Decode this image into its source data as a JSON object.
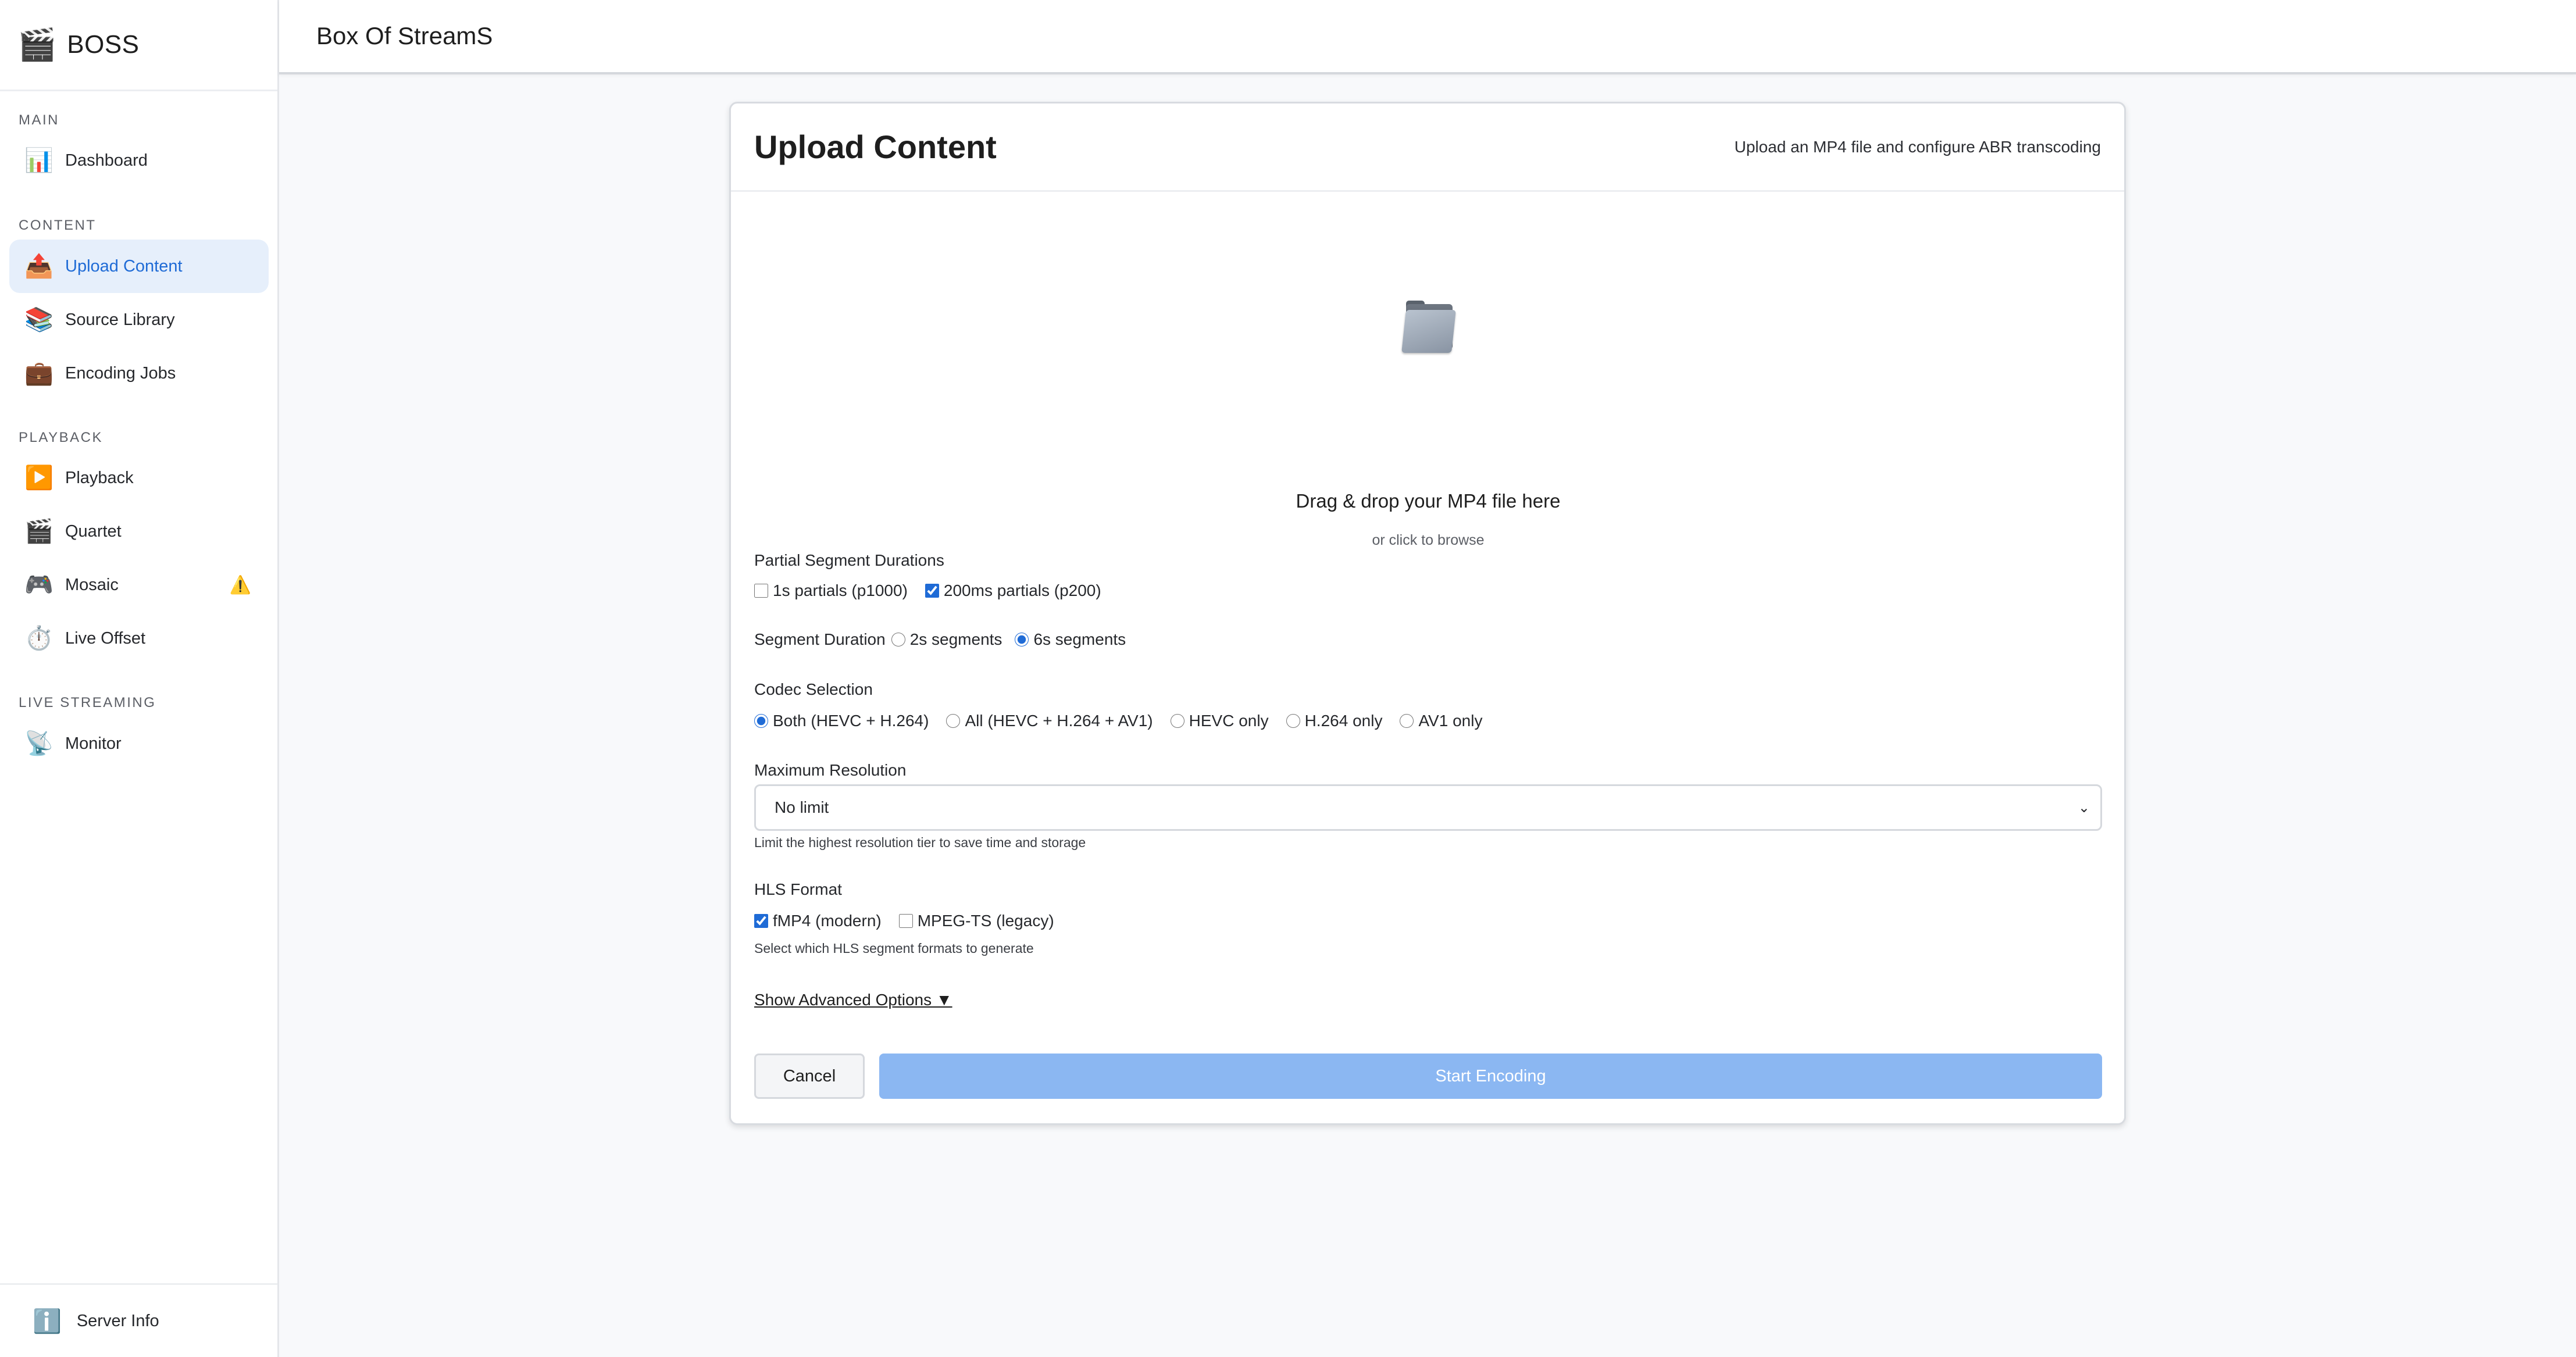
{
  "brand": {
    "icon": "clapper-icon",
    "name": "BOSS"
  },
  "header": {
    "title": "Box Of StreamS"
  },
  "sidebar": {
    "sections": [
      {
        "label": "MAIN"
      },
      {
        "label": "CONTENT"
      },
      {
        "label": "PLAYBACK"
      },
      {
        "label": "LIVE STREAMING"
      }
    ],
    "items": [
      {
        "label": "Dashboard",
        "icon": "bar-chart-icon",
        "glyph": "📊",
        "active": false
      },
      {
        "label": "Upload Content",
        "icon": "upload-inbox-icon",
        "glyph": "📤",
        "active": true
      },
      {
        "label": "Source Library",
        "icon": "books-icon",
        "glyph": "📚",
        "active": false
      },
      {
        "label": "Encoding Jobs",
        "icon": "briefcase-icon",
        "glyph": "💼",
        "active": false
      },
      {
        "label": "Playback",
        "icon": "play-button-icon",
        "glyph": "▶️",
        "active": false
      },
      {
        "label": "Quartet",
        "icon": "clapper-icon",
        "glyph": "🎬",
        "active": false
      },
      {
        "label": "Mosaic",
        "icon": "gamepad-icon",
        "glyph": "🎮",
        "active": false,
        "badge": "⚠️"
      },
      {
        "label": "Live Offset",
        "icon": "stopwatch-icon",
        "glyph": "⏱️",
        "active": false
      },
      {
        "label": "Monitor",
        "icon": "satellite-dish-icon",
        "glyph": "📡",
        "active": false
      }
    ],
    "footer": {
      "label": "Server Info",
      "icon": "info-icon",
      "glyph": "ℹ️"
    }
  },
  "card": {
    "title": "Upload Content",
    "subtitle": "Upload an MP4 file and configure ABR transcoding",
    "dropzone": {
      "icon": "folder-icon",
      "title": "Drag & drop your MP4 file here",
      "subtitle": "or click to browse"
    },
    "partials": {
      "label": "Partial Segment Durations",
      "options": [
        {
          "label": "1s partials (p1000)",
          "checked": false
        },
        {
          "label": "200ms partials (p200)",
          "checked": true
        }
      ]
    },
    "segment": {
      "label": "Segment Duration",
      "options": [
        {
          "label": "2s segments",
          "checked": false
        },
        {
          "label": "6s segments",
          "checked": true
        }
      ]
    },
    "codec": {
      "label": "Codec Selection",
      "options": [
        {
          "label": "Both (HEVC + H.264)",
          "checked": true
        },
        {
          "label": "All (HEVC + H.264 + AV1)",
          "checked": false
        },
        {
          "label": "HEVC only",
          "checked": false
        },
        {
          "label": "H.264 only",
          "checked": false
        },
        {
          "label": "AV1 only",
          "checked": false
        }
      ]
    },
    "resolution": {
      "label": "Maximum Resolution",
      "value": "No limit",
      "hint": "Limit the highest resolution tier to save time and storage"
    },
    "hls": {
      "label": "HLS Format",
      "options": [
        {
          "label": "fMP4 (modern)",
          "checked": true
        },
        {
          "label": "MPEG-TS (legacy)",
          "checked": false
        }
      ],
      "hint": "Select which HLS segment formats to generate"
    },
    "advanced_label": "Show Advanced Options ▼",
    "cancel_label": "Cancel",
    "start_label": "Start Encoding"
  }
}
